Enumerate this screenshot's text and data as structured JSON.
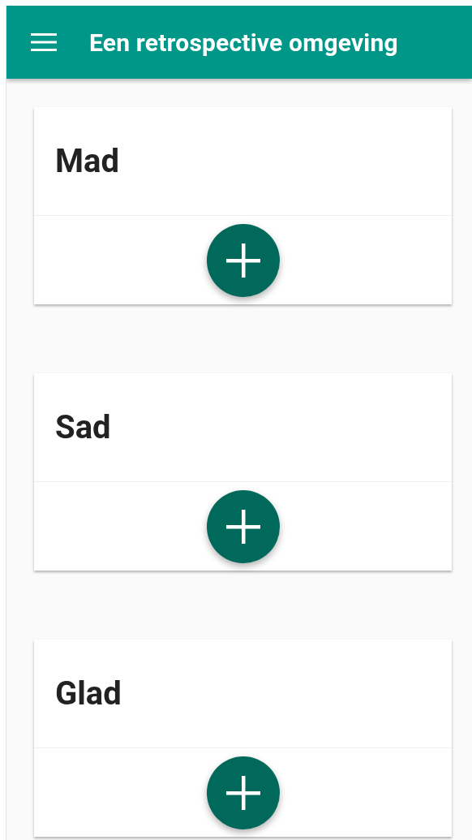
{
  "app_bar": {
    "title": "Een retrospective omgeving"
  },
  "columns": [
    {
      "title": "Mad"
    },
    {
      "title": "Sad"
    },
    {
      "title": "Glad"
    }
  ]
}
